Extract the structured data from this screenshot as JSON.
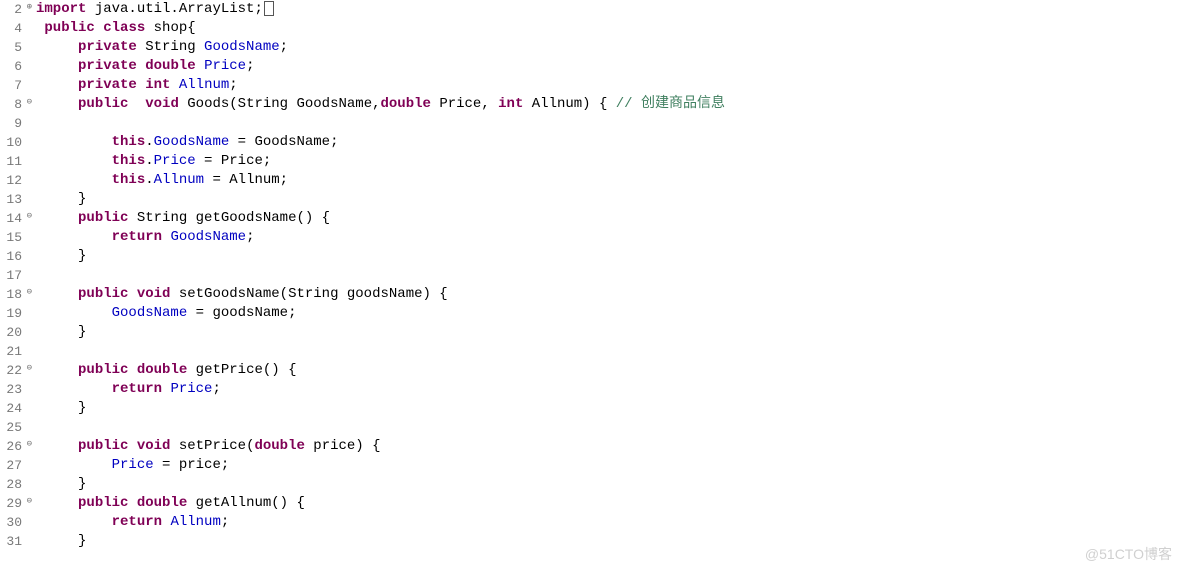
{
  "watermark": "@51CTO博客",
  "lines": [
    {
      "num": "2",
      "marker": "⊕",
      "tokens": [
        {
          "c": "kw",
          "t": "import"
        },
        {
          "c": "plain",
          "t": " java.util.ArrayList;"
        },
        {
          "c": "cursor",
          "t": ""
        }
      ]
    },
    {
      "num": "4",
      "tokens": [
        {
          "c": "plain",
          "t": " "
        },
        {
          "c": "kw",
          "t": "public"
        },
        {
          "c": "plain",
          "t": " "
        },
        {
          "c": "kw",
          "t": "class"
        },
        {
          "c": "plain",
          "t": " shop{"
        }
      ]
    },
    {
      "num": "5",
      "tokens": [
        {
          "c": "plain",
          "t": "     "
        },
        {
          "c": "kw",
          "t": "private"
        },
        {
          "c": "plain",
          "t": " String "
        },
        {
          "c": "field",
          "t": "GoodsName"
        },
        {
          "c": "plain",
          "t": ";"
        }
      ]
    },
    {
      "num": "6",
      "tokens": [
        {
          "c": "plain",
          "t": "     "
        },
        {
          "c": "kw",
          "t": "private"
        },
        {
          "c": "plain",
          "t": " "
        },
        {
          "c": "kw",
          "t": "double"
        },
        {
          "c": "plain",
          "t": " "
        },
        {
          "c": "field",
          "t": "Price"
        },
        {
          "c": "plain",
          "t": ";"
        }
      ]
    },
    {
      "num": "7",
      "tokens": [
        {
          "c": "plain",
          "t": "     "
        },
        {
          "c": "kw",
          "t": "private"
        },
        {
          "c": "plain",
          "t": " "
        },
        {
          "c": "kw",
          "t": "int"
        },
        {
          "c": "plain",
          "t": " "
        },
        {
          "c": "field",
          "t": "Allnum"
        },
        {
          "c": "plain",
          "t": ";"
        }
      ]
    },
    {
      "num": "8",
      "marker": "⊖",
      "tokens": [
        {
          "c": "plain",
          "t": "     "
        },
        {
          "c": "kw",
          "t": "public"
        },
        {
          "c": "plain",
          "t": "  "
        },
        {
          "c": "kw",
          "t": "void"
        },
        {
          "c": "plain",
          "t": " Goods(String GoodsName,"
        },
        {
          "c": "kw",
          "t": "double"
        },
        {
          "c": "plain",
          "t": " Price, "
        },
        {
          "c": "kw",
          "t": "int"
        },
        {
          "c": "plain",
          "t": " Allnum) { "
        },
        {
          "c": "cm",
          "t": "// 创建商品信息"
        }
      ]
    },
    {
      "num": "9",
      "tokens": []
    },
    {
      "num": "10",
      "tokens": [
        {
          "c": "plain",
          "t": "         "
        },
        {
          "c": "kw",
          "t": "this"
        },
        {
          "c": "plain",
          "t": "."
        },
        {
          "c": "field",
          "t": "GoodsName"
        },
        {
          "c": "plain",
          "t": " = GoodsName;"
        }
      ]
    },
    {
      "num": "11",
      "tokens": [
        {
          "c": "plain",
          "t": "         "
        },
        {
          "c": "kw",
          "t": "this"
        },
        {
          "c": "plain",
          "t": "."
        },
        {
          "c": "field",
          "t": "Price"
        },
        {
          "c": "plain",
          "t": " = Price;"
        }
      ]
    },
    {
      "num": "12",
      "tokens": [
        {
          "c": "plain",
          "t": "         "
        },
        {
          "c": "kw",
          "t": "this"
        },
        {
          "c": "plain",
          "t": "."
        },
        {
          "c": "field",
          "t": "Allnum"
        },
        {
          "c": "plain",
          "t": " = Allnum;"
        }
      ]
    },
    {
      "num": "13",
      "tokens": [
        {
          "c": "plain",
          "t": "     }"
        }
      ]
    },
    {
      "num": "14",
      "marker": "⊖",
      "tokens": [
        {
          "c": "plain",
          "t": "     "
        },
        {
          "c": "kw",
          "t": "public"
        },
        {
          "c": "plain",
          "t": " String getGoodsName() {"
        }
      ]
    },
    {
      "num": "15",
      "tokens": [
        {
          "c": "plain",
          "t": "         "
        },
        {
          "c": "kw",
          "t": "return"
        },
        {
          "c": "plain",
          "t": " "
        },
        {
          "c": "field",
          "t": "GoodsName"
        },
        {
          "c": "plain",
          "t": ";"
        }
      ]
    },
    {
      "num": "16",
      "tokens": [
        {
          "c": "plain",
          "t": "     }"
        }
      ]
    },
    {
      "num": "17",
      "tokens": []
    },
    {
      "num": "18",
      "marker": "⊖",
      "tokens": [
        {
          "c": "plain",
          "t": "     "
        },
        {
          "c": "kw",
          "t": "public"
        },
        {
          "c": "plain",
          "t": " "
        },
        {
          "c": "kw",
          "t": "void"
        },
        {
          "c": "plain",
          "t": " setGoodsName(String goodsName) {"
        }
      ]
    },
    {
      "num": "19",
      "tokens": [
        {
          "c": "plain",
          "t": "         "
        },
        {
          "c": "field",
          "t": "GoodsName"
        },
        {
          "c": "plain",
          "t": " = goodsName;"
        }
      ]
    },
    {
      "num": "20",
      "tokens": [
        {
          "c": "plain",
          "t": "     }"
        }
      ]
    },
    {
      "num": "21",
      "tokens": []
    },
    {
      "num": "22",
      "marker": "⊖",
      "tokens": [
        {
          "c": "plain",
          "t": "     "
        },
        {
          "c": "kw",
          "t": "public"
        },
        {
          "c": "plain",
          "t": " "
        },
        {
          "c": "kw",
          "t": "double"
        },
        {
          "c": "plain",
          "t": " getPrice() {"
        }
      ]
    },
    {
      "num": "23",
      "tokens": [
        {
          "c": "plain",
          "t": "         "
        },
        {
          "c": "kw",
          "t": "return"
        },
        {
          "c": "plain",
          "t": " "
        },
        {
          "c": "field",
          "t": "Price"
        },
        {
          "c": "plain",
          "t": ";"
        }
      ]
    },
    {
      "num": "24",
      "tokens": [
        {
          "c": "plain",
          "t": "     }"
        }
      ]
    },
    {
      "num": "25",
      "tokens": []
    },
    {
      "num": "26",
      "marker": "⊖",
      "tokens": [
        {
          "c": "plain",
          "t": "     "
        },
        {
          "c": "kw",
          "t": "public"
        },
        {
          "c": "plain",
          "t": " "
        },
        {
          "c": "kw",
          "t": "void"
        },
        {
          "c": "plain",
          "t": " setPrice("
        },
        {
          "c": "kw",
          "t": "double"
        },
        {
          "c": "plain",
          "t": " price) {"
        }
      ]
    },
    {
      "num": "27",
      "tokens": [
        {
          "c": "plain",
          "t": "         "
        },
        {
          "c": "field",
          "t": "Price"
        },
        {
          "c": "plain",
          "t": " = price;"
        }
      ]
    },
    {
      "num": "28",
      "tokens": [
        {
          "c": "plain",
          "t": "     }"
        }
      ]
    },
    {
      "num": "29",
      "marker": "⊖",
      "tokens": [
        {
          "c": "plain",
          "t": "     "
        },
        {
          "c": "kw",
          "t": "public"
        },
        {
          "c": "plain",
          "t": " "
        },
        {
          "c": "kw",
          "t": "double"
        },
        {
          "c": "plain",
          "t": " getAllnum() {"
        }
      ]
    },
    {
      "num": "30",
      "tokens": [
        {
          "c": "plain",
          "t": "         "
        },
        {
          "c": "kw",
          "t": "return"
        },
        {
          "c": "plain",
          "t": " "
        },
        {
          "c": "field",
          "t": "Allnum"
        },
        {
          "c": "plain",
          "t": ";"
        }
      ]
    },
    {
      "num": "31",
      "tokens": [
        {
          "c": "plain",
          "t": "     }"
        }
      ]
    }
  ]
}
